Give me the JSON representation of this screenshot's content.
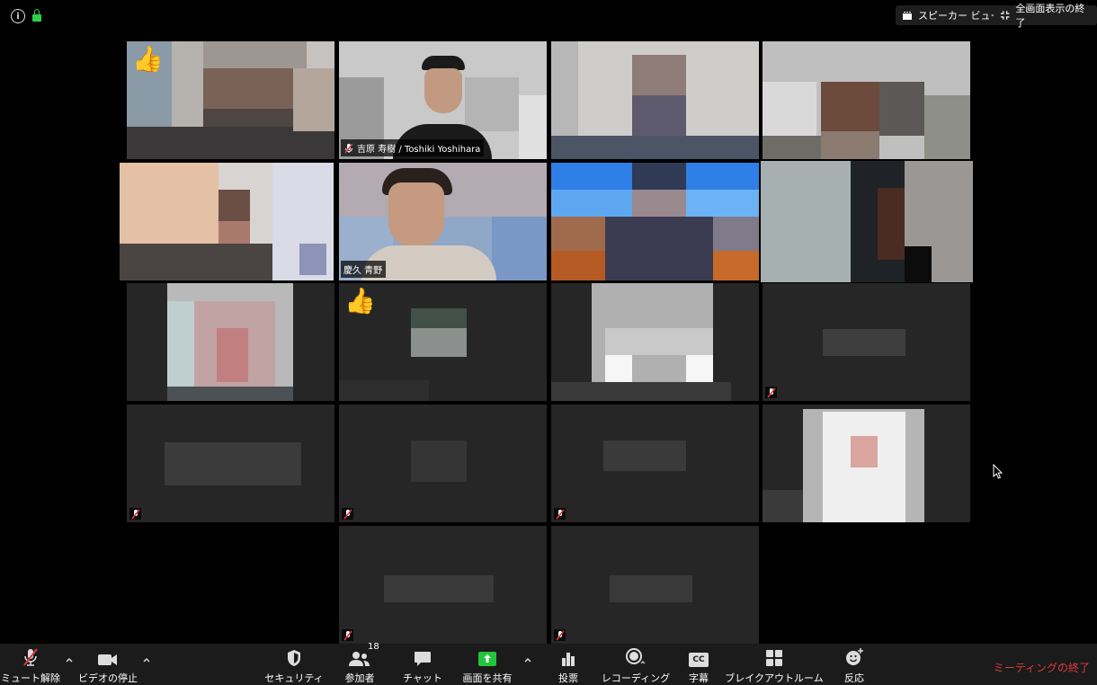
{
  "top_bar": {
    "icons": [
      "info-icon",
      "lock-icon"
    ],
    "speaker_view_label": "スピーカー ビュー",
    "exit_fullscreen_label": "全画面表示の終了"
  },
  "participants": {
    "p2_name": "吉原 寿樹 / Toshiki Yoshihara",
    "p6_name": "慶久 青野"
  },
  "reactions": [
    "thumbs-up",
    "thumbs-up"
  ],
  "reaction_glyph": "👍",
  "toolbar": {
    "mute_label": "ミュート解除",
    "video_label": "ビデオの停止",
    "security_label": "セキュリティ",
    "participants_label": "参加者",
    "participants_count": "18",
    "chat_label": "チャット",
    "share_label": "画面を共有",
    "poll_label": "投票",
    "record_label": "レコーディング",
    "captions_label": "字幕",
    "captions_icon_text": "CC",
    "breakout_label": "ブレイクアウトルーム",
    "reactions_label": "反応",
    "end_label": "ミーティングの終了"
  },
  "colors": {
    "active_speaker_border": "#c7df63",
    "end_meeting": "#e0393e",
    "share_green": "#23c53a",
    "muted_red": "#e0393e"
  }
}
